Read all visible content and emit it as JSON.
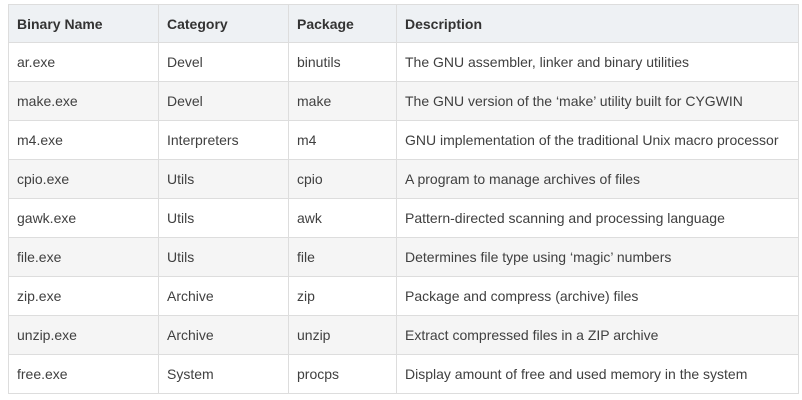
{
  "table": {
    "headers": [
      "Binary Name",
      "Category",
      "Package",
      "Description"
    ],
    "rows": [
      [
        "ar.exe",
        "Devel",
        "binutils",
        "The GNU assembler, linker and binary utilities"
      ],
      [
        "make.exe",
        "Devel",
        "make",
        "The GNU version of the ‘make’ utility built for CYGWIN"
      ],
      [
        "m4.exe",
        "Interpreters",
        "m4",
        "GNU implementation of the traditional Unix macro processor"
      ],
      [
        "cpio.exe",
        "Utils",
        "cpio",
        "A program to manage archives of files"
      ],
      [
        "gawk.exe",
        "Utils",
        "awk",
        "Pattern-directed scanning and processing language"
      ],
      [
        "file.exe",
        "Utils",
        "file",
        "Determines file type using ‘magic’ numbers"
      ],
      [
        "zip.exe",
        "Archive",
        "zip",
        "Package and compress (archive) files"
      ],
      [
        "unzip.exe",
        "Archive",
        "unzip",
        "Extract compressed files in a ZIP archive"
      ],
      [
        "free.exe",
        "System",
        "procps",
        "Display amount of free and used memory in the system"
      ]
    ]
  }
}
